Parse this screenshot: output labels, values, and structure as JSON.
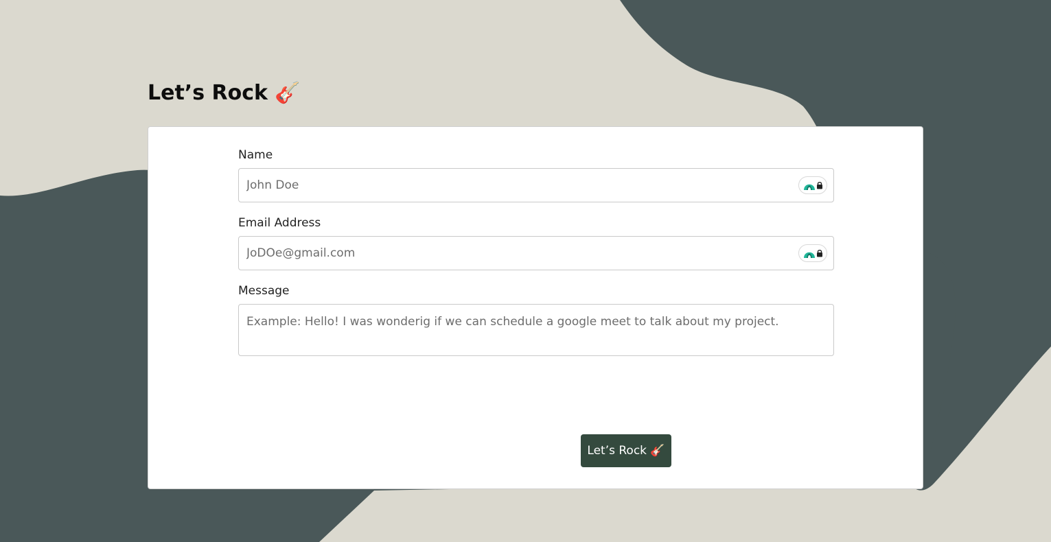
{
  "page": {
    "title": "Let’s Rock 🎸"
  },
  "form": {
    "name": {
      "label": "Name",
      "placeholder": "John Doe"
    },
    "email": {
      "label": "Email Address",
      "placeholder": "JoDOe@gmail.com"
    },
    "message": {
      "label": "Message",
      "placeholder": "Example: Hello! I was wonderig if we can schedule a google meet to talk about my project."
    },
    "submit_label": "Let’s Rock 🎸"
  },
  "icons": {
    "field_badge": "password-manager-lock-icon"
  },
  "colors": {
    "background_light": "#dbd9cf",
    "background_dark": "#4a5859",
    "button": "#344a3e",
    "badge_accent": "#1fb89a"
  }
}
